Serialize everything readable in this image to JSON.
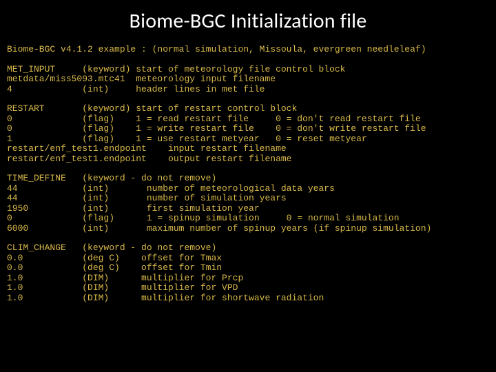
{
  "title": "Biome-BGC Initialization file",
  "header_line": "Biome-BGC v4.1.2 example : (normal simulation, Missoula, evergreen needleleaf)",
  "blocks": {
    "met_input": [
      "MET_INPUT     (keyword) start of meteorology file control block",
      "metdata/miss5093.mtc41  meteorology input filename",
      "4             (int)     header lines in met file"
    ],
    "restart": [
      "RESTART       (keyword) start of restart control block",
      "0             (flag)    1 = read restart file     0 = don't read restart file",
      "0             (flag)    1 = write restart file    0 = don't write restart file",
      "1             (flag)    1 = use restart metyear   0 = reset metyear",
      "restart/enf_test1.endpoint    input restart filename",
      "restart/enf_test1.endpoint    output restart filename"
    ],
    "time_define": [
      "TIME_DEFINE   (keyword - do not remove)",
      "44            (int)       number of meteorological data years",
      "44            (int)       number of simulation years",
      "1950          (int)       first simulation year",
      "0             (flag)      1 = spinup simulation     0 = normal simulation",
      "6000          (int)       maximum number of spinup years (if spinup simulation)"
    ],
    "clim_change": [
      "CLIM_CHANGE   (keyword - do not remove)",
      "0.0           (deg C)    offset for Tmax",
      "0.0           (deg C)    offset for Tmin",
      "1.0           (DIM)      multiplier for Prcp",
      "1.0           (DIM)      multiplier for VPD",
      "1.0           (DIM)      multiplier for shortwave radiation"
    ]
  }
}
